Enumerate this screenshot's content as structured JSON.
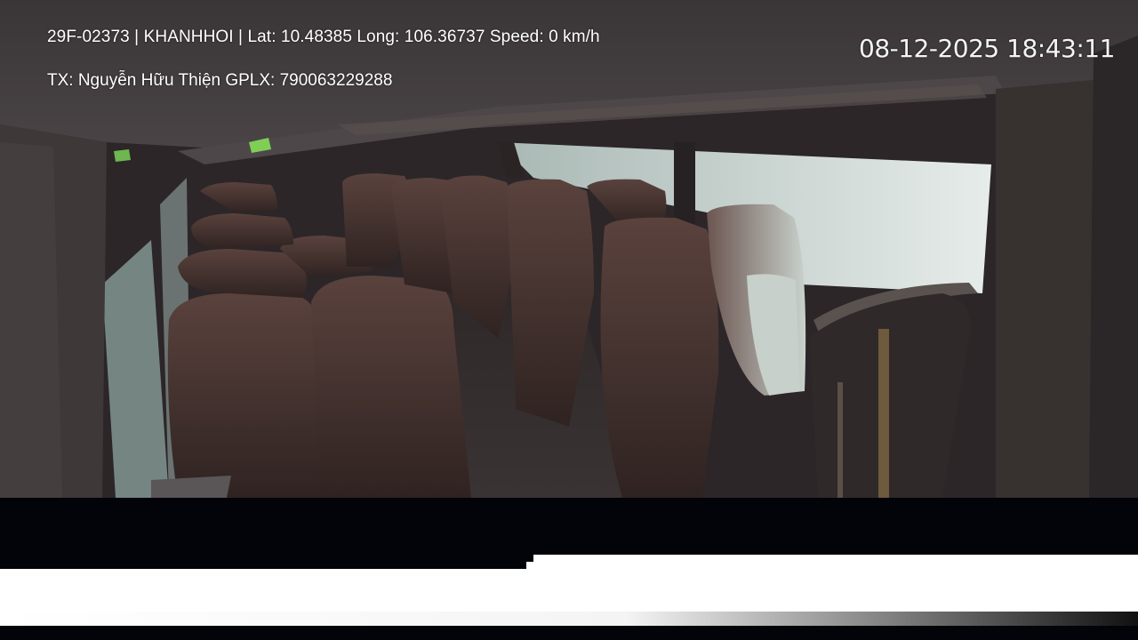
{
  "overlay": {
    "info_line": "29F-02373 | KHANHHOI | Lat: 10.48385 Long: 106.36737 Speed: 0 km/h",
    "driver_line": "TX: Nguyễn Hữu Thiện GPLX: 790063229288",
    "timestamp": "08-12-2025 18:43:11"
  },
  "colors": {
    "overlay_text": "#ffffff",
    "cabin_dark": "#2a2426",
    "seat_brown": "#4a3430",
    "window_light": "#d6dedd",
    "letterbox": "#000000",
    "white_band": "#ffffff"
  }
}
